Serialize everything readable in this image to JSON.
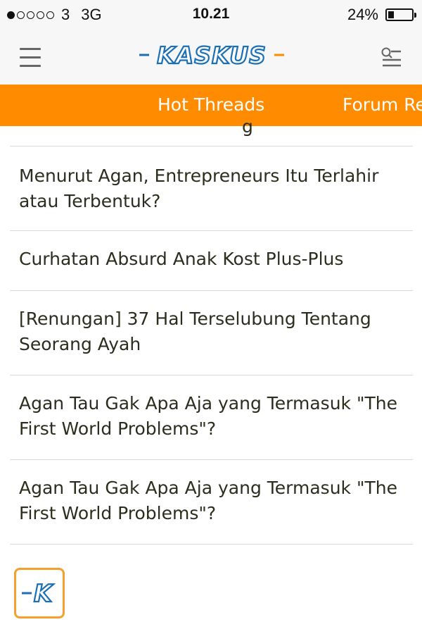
{
  "status_bar": {
    "signal_dots_filled": 1,
    "signal_dots_total": 5,
    "carrier": "3",
    "network": "3G",
    "time": "10.21",
    "battery_percent": "24%",
    "battery_level": 0.24
  },
  "header": {
    "logo_text": "KASKUS",
    "menu_icon": "hamburger-icon",
    "search_icon": "search-list-icon"
  },
  "tabs": [
    {
      "label": "Hot Threads"
    },
    {
      "label": "Forum Re"
    }
  ],
  "threads": [
    {
      "title": "Menurut Agan, Entrepreneurs Itu Terlahir atau Terbentuk?"
    },
    {
      "title": "Curhatan Absurd Anak Kost Plus-Plus"
    },
    {
      "title": "[Renungan] 37 Hal Terselubung Tentang Seorang Ayah"
    },
    {
      "title": "Agan Tau Gak Apa Aja yang Termasuk \"The First World Problems\"?"
    },
    {
      "title": "Agan Tau Gak Apa Aja yang Termasuk \"The First World Problems\"?"
    }
  ],
  "colors": {
    "accent": "#ff8b00",
    "logo_blue": "#1a6fb5",
    "logo_orange": "#ff8b00",
    "text": "#2d2d1e",
    "divider": "#d9d9d9"
  },
  "floating_button": {
    "icon": "kaskus-k-icon"
  }
}
